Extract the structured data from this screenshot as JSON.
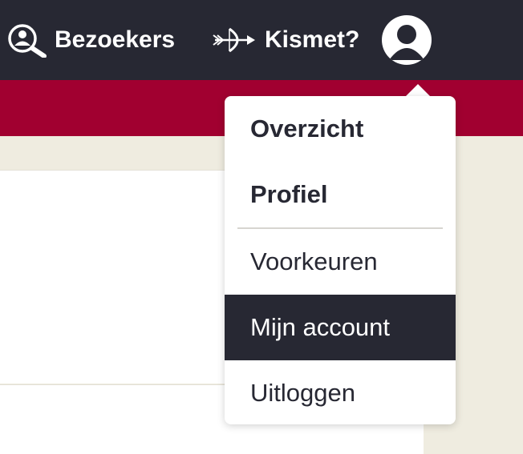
{
  "colors": {
    "navbar": "#272833",
    "accent_bar": "#a10030",
    "page_background": "#efece0",
    "card": "#ffffff",
    "menu_active": "#272833"
  },
  "nav": {
    "visitors": {
      "label": "Bezoekers",
      "icon": "visitor-search-icon"
    },
    "kismet": {
      "label": "Kismet?",
      "icon": "bow-arrow-icon"
    },
    "account": {
      "icon": "user-avatar-icon"
    }
  },
  "dropdown": {
    "items": [
      {
        "label": "Overzicht",
        "bold": true
      },
      {
        "label": "Profiel",
        "bold": true
      },
      {
        "label": "Voorkeuren",
        "bold": false
      },
      {
        "label": "Mijn account",
        "bold": false,
        "active": true
      },
      {
        "label": "Uitloggen",
        "bold": false
      }
    ]
  }
}
